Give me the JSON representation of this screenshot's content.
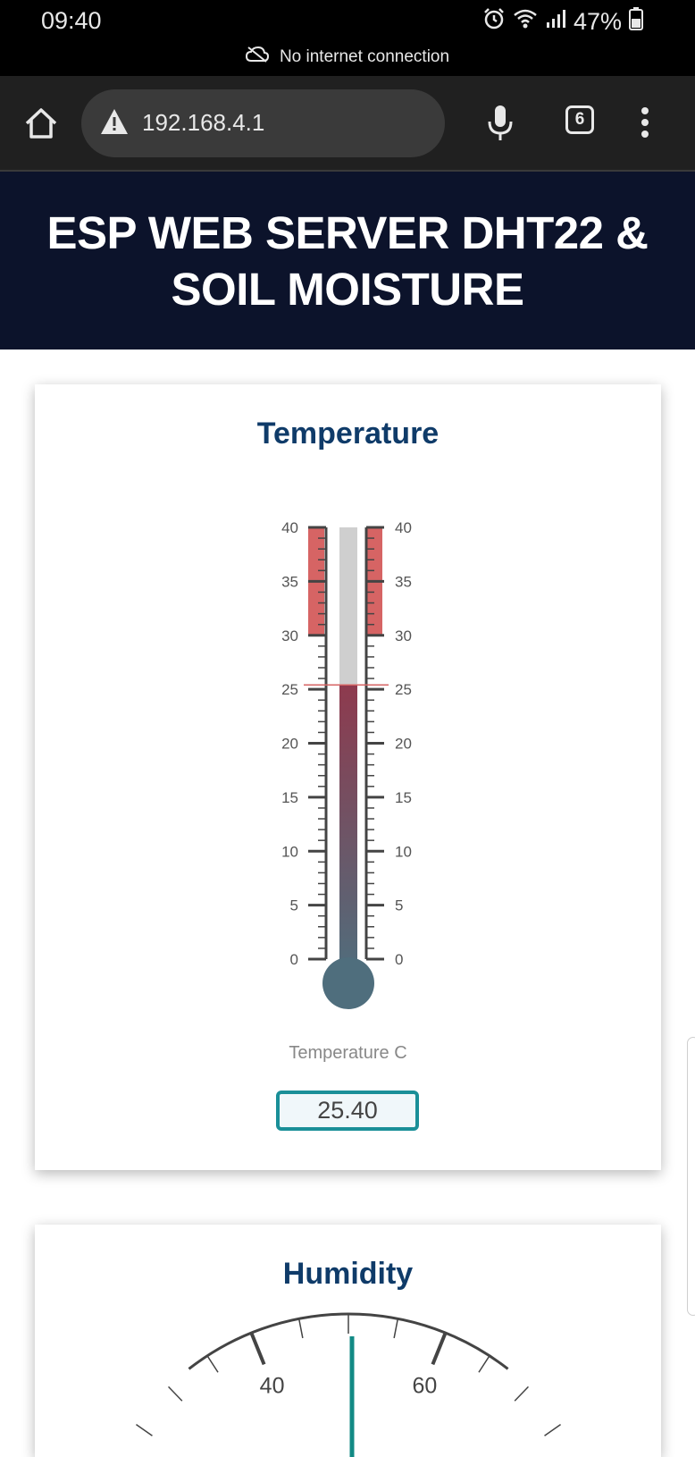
{
  "status_bar": {
    "time": "09:40",
    "battery": "47%",
    "network_message": "No internet connection"
  },
  "browser": {
    "url": "192.168.4.1",
    "tab_count": "6"
  },
  "header": {
    "title": "ESP WEB SERVER DHT22 & SOIL MOISTURE"
  },
  "temperature_card": {
    "title": "Temperature",
    "label": "Temperature C",
    "value": "25.40",
    "scale_ticks": [
      "40",
      "35",
      "30",
      "25",
      "20",
      "15",
      "10",
      "5",
      "0"
    ],
    "scale_min": 0,
    "scale_max": 40,
    "danger_from": 30,
    "reading": 25.4,
    "colors": {
      "danger": "#d66464",
      "mercury_top": "#8e3a4e",
      "mercury_bottom": "#4f6e7d",
      "tube": "#cfcfcf"
    }
  },
  "humidity_card": {
    "title": "Humidity",
    "gauge_labels": [
      "40",
      "60"
    ]
  },
  "colors": {
    "header_bg": "#0c132b",
    "card_title": "#0f3b69",
    "value_border": "#1a8f98",
    "gauge_needle": "#128a85"
  }
}
